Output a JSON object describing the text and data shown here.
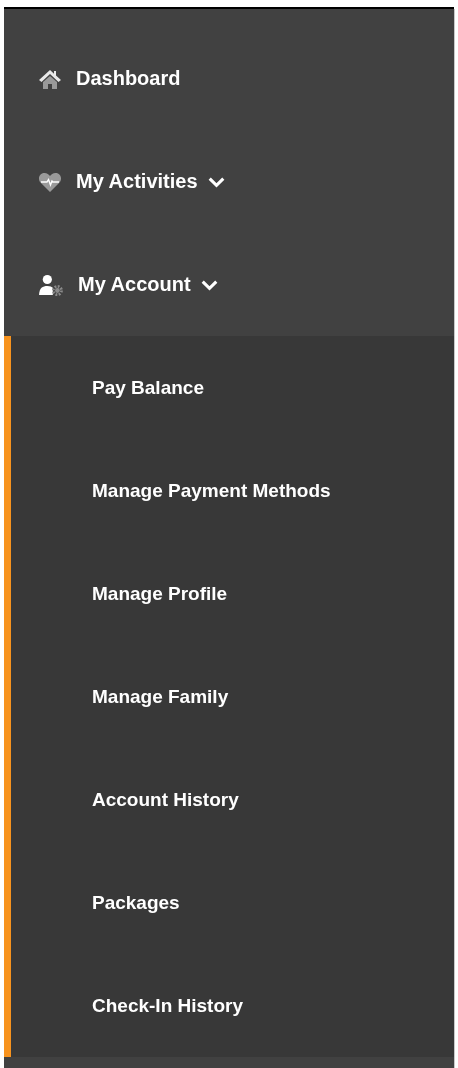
{
  "nav": [
    {
      "kind": "link",
      "label": "Dashboard"
    },
    {
      "kind": "group",
      "label": "My Activities"
    },
    {
      "kind": "group",
      "label": "My Account",
      "expanded": true,
      "children": [
        {
          "label": "Pay Balance"
        },
        {
          "label": "Manage Payment Methods"
        },
        {
          "label": "Manage Profile"
        },
        {
          "label": "Manage Family"
        },
        {
          "label": "Account History"
        },
        {
          "label": "Packages"
        },
        {
          "label": "Check-In History"
        }
      ]
    }
  ]
}
